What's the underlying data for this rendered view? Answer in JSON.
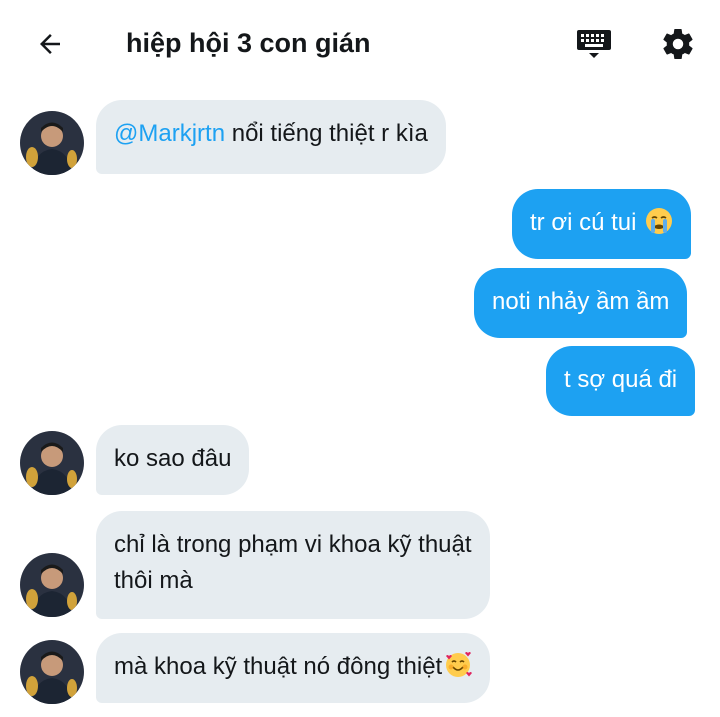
{
  "header": {
    "title": "hiệp hội 3 con gián",
    "icons": [
      "back-arrow-icon",
      "keyboard-icon",
      "gear-icon"
    ]
  },
  "messages": [
    {
      "direction": "incoming",
      "mention": "@Markjrtn",
      "text": " nổi tiếng thiệt r kìa"
    },
    {
      "direction": "outgoing",
      "text": "tr ơi cú tui",
      "emoji": "crying-face-icon"
    },
    {
      "direction": "outgoing",
      "text": "noti nhảy ầm ầm"
    },
    {
      "direction": "outgoing",
      "text": "t sợ quá đi"
    },
    {
      "direction": "incoming",
      "text": "ko sao đâu"
    },
    {
      "direction": "incoming",
      "line1": "chỉ là trong phạm vi khoa kỹ thuật",
      "line2": "thôi mà"
    },
    {
      "direction": "incoming",
      "text": "mà khoa kỹ thuật nó đông thiệt",
      "emoji": "smiling-face-with-hearts-icon"
    }
  ],
  "colors": {
    "accent": "#1da1f2",
    "incoming_bubble": "#e6ecf0",
    "text": "#14171a"
  }
}
